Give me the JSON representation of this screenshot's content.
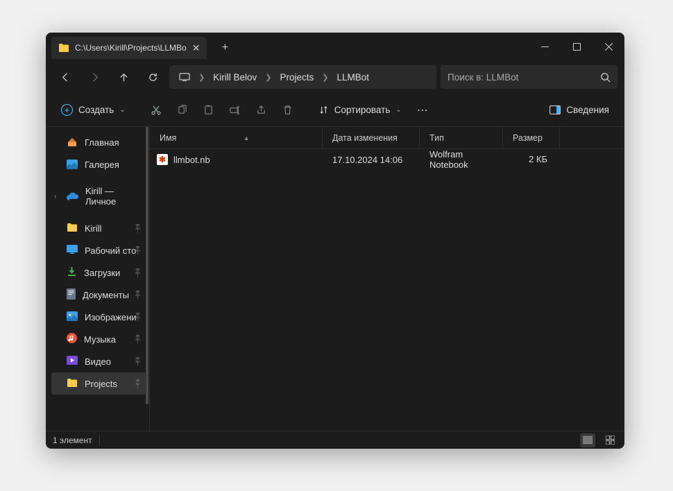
{
  "window": {
    "tab_title": "C:\\Users\\Kirill\\Projects\\LLMBo"
  },
  "breadcrumb": {
    "segments": [
      "Kirill Belov",
      "Projects",
      "LLMBot"
    ]
  },
  "search": {
    "placeholder": "Поиск в: LLMBot"
  },
  "toolbar": {
    "create_label": "Создать",
    "sort_label": "Сортировать",
    "details_label": "Сведения"
  },
  "sidebar": {
    "home": "Главная",
    "gallery": "Галерея",
    "onedrive": "Kirill — Личное",
    "quick": [
      {
        "icon": "folder",
        "label": "Kirill",
        "pinned": true
      },
      {
        "icon": "desktop",
        "label": "Рабочий сто",
        "pinned": true
      },
      {
        "icon": "download",
        "label": "Загрузки",
        "pinned": true
      },
      {
        "icon": "doc",
        "label": "Документы",
        "pinned": true
      },
      {
        "icon": "image",
        "label": "Изображени",
        "pinned": true
      },
      {
        "icon": "music",
        "label": "Музыка",
        "pinned": true
      },
      {
        "icon": "video",
        "label": "Видео",
        "pinned": true
      },
      {
        "icon": "folder",
        "label": "Projects",
        "pinned": true,
        "selected": true
      }
    ]
  },
  "columns": {
    "name": "Имя",
    "date": "Дата изменения",
    "type": "Тип",
    "size": "Размер"
  },
  "files": [
    {
      "name": "llmbot.nb",
      "date": "17.10.2024 14:06",
      "type": "Wolfram Notebook",
      "size": "2 КБ"
    }
  ],
  "status": {
    "count": "1 элемент"
  }
}
